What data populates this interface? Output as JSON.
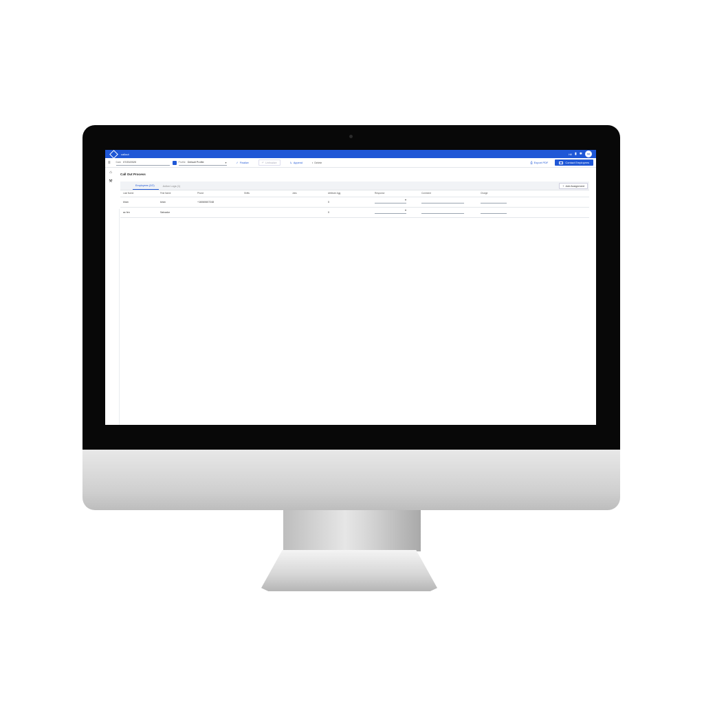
{
  "app": {
    "title": "callout",
    "user_text": "Hi!",
    "avatar_initials": "SO"
  },
  "toolbar": {
    "date_label": "Date",
    "date_value": "07/20/2020",
    "profile_label": "Profile",
    "profile_value": "Default Profile",
    "finalize_label": "Finalize",
    "unfinalize_label": "Unfinalize",
    "append_label": "Append",
    "delete_label": "Delete",
    "export_pdf_label": "Export PDF",
    "contact_label": "Contact Employees"
  },
  "page": {
    "title": "Call Out Process"
  },
  "tabs": [
    {
      "label": "Employees (2/2)",
      "active": true
    },
    {
      "label": "Action Logs (1)",
      "active": false
    }
  ],
  "add_assignment_label": "Add Assignment",
  "table": {
    "headers": [
      "Last Name",
      "First Name",
      "Phone",
      "Shifts",
      "Jobs",
      "Attribute Agg",
      "Response",
      "Comment",
      "Charge"
    ],
    "rows": [
      {
        "last": "khan",
        "first": "kiran",
        "phone": "+16060607248",
        "shifts": "",
        "jobs": "",
        "attr": "0"
      },
      {
        "last": "ac fen",
        "first": "Salvador",
        "phone": "",
        "shifts": "",
        "jobs": "",
        "attr": "0"
      }
    ]
  },
  "colors": {
    "primary": "#1f57d6"
  }
}
